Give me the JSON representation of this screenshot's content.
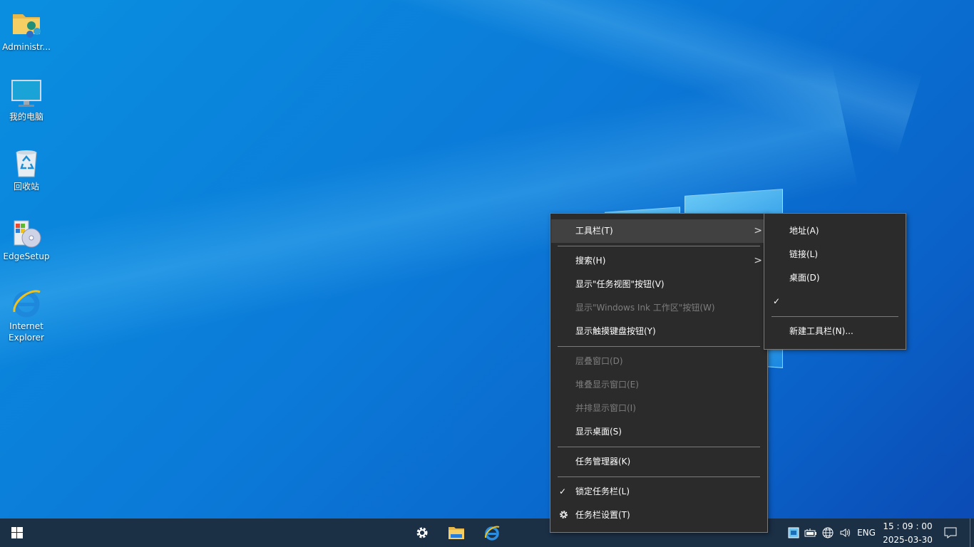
{
  "desktop": {
    "icons": [
      {
        "label": "Administr..."
      },
      {
        "label": "我的电脑"
      },
      {
        "label": "回收站"
      },
      {
        "label": "EdgeSetup"
      },
      {
        "label": "Internet Explorer"
      }
    ]
  },
  "context_menu": {
    "items": {
      "toolbars": "工具栏(T)",
      "search": "搜索(H)",
      "task_view": "显示\"任务视图\"按钮(V)",
      "ink_workspace": "显示\"Windows Ink 工作区\"按钮(W)",
      "touch_keyboard": "显示触摸键盘按钮(Y)",
      "cascade": "层叠窗口(D)",
      "stacked": "堆叠显示窗口(E)",
      "side_by_side": "并排显示窗口(I)",
      "show_desktop": "显示桌面(S)",
      "task_manager": "任务管理器(K)",
      "lock_taskbar": "锁定任务栏(L)",
      "taskbar_settings": "任务栏设置(T)"
    },
    "submenu_arrow": ">",
    "check_mark": "✓"
  },
  "toolbars_submenu": {
    "items": {
      "address": "地址(A)",
      "links": "链接(L)",
      "desktop": "桌面(D)",
      "new_toolbar": "新建工具栏(N)..."
    }
  },
  "taskbar": {
    "tray": {
      "language": "ENG"
    },
    "clock": {
      "time": "15 : 09 : 00",
      "date": "2025-03-30"
    }
  },
  "colors": {
    "taskbar": "#1b2f45",
    "menu_bg": "#2b2b2b",
    "menu_highlight": "#414141",
    "disabled_text": "#7d7d7d"
  }
}
